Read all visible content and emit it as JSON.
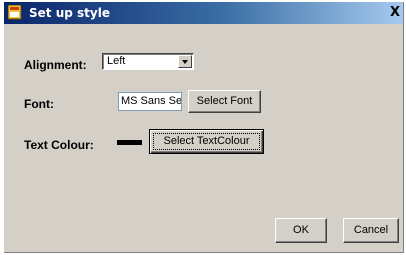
{
  "window": {
    "title": "Set up style",
    "close_label": "X",
    "icon": "app-window-icon"
  },
  "alignment": {
    "label": "Alignment:",
    "selected": "Left",
    "icon": "chevron-down-icon"
  },
  "font": {
    "label": "Font:",
    "value": "MS Sans Serif",
    "button_label": "Select Font"
  },
  "text_colour": {
    "label": "Text Colour:",
    "swatch_color": "#000000",
    "button_label": "Select TextColour"
  },
  "buttons": {
    "ok_label": "OK",
    "cancel_label": "Cancel"
  },
  "colors": {
    "title_bar_start": "#0a246a",
    "title_bar_end": "#a6caf0",
    "face": "#d4d0c8"
  }
}
